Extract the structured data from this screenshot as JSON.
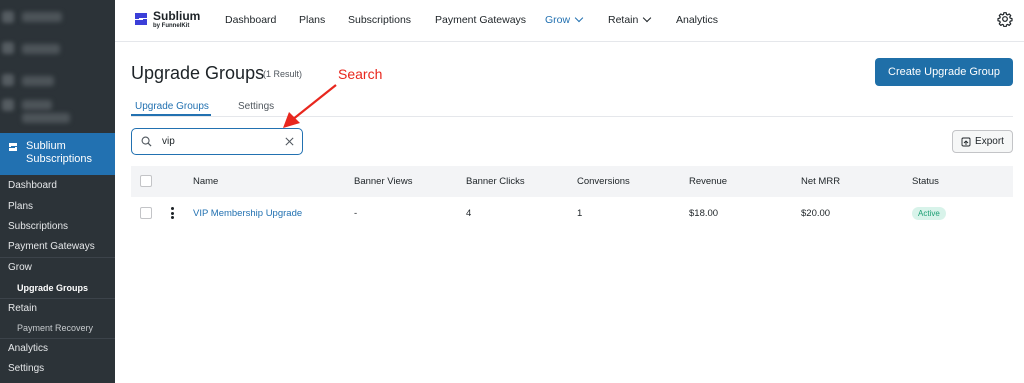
{
  "sidebar": {
    "active_label_line1": "Sublium",
    "active_label_line2": "Subscriptions",
    "items": [
      {
        "label": "Dashboard"
      },
      {
        "label": "Plans"
      },
      {
        "label": "Subscriptions"
      },
      {
        "label": "Payment Gateways"
      },
      {
        "label": "Grow"
      },
      {
        "label": "Upgrade Groups"
      },
      {
        "label": "Retain"
      },
      {
        "label": "Payment Recovery"
      },
      {
        "label": "Analytics"
      },
      {
        "label": "Settings"
      }
    ]
  },
  "brand": {
    "name": "Sublium",
    "sub": "by FunnelKit",
    "color": "#1d2327"
  },
  "topnav": {
    "items": [
      {
        "label": "Dashboard"
      },
      {
        "label": "Plans"
      },
      {
        "label": "Subscriptions"
      },
      {
        "label": "Payment Gateways"
      },
      {
        "label": "Grow"
      },
      {
        "label": "Retain"
      },
      {
        "label": "Analytics"
      }
    ],
    "active": "Grow"
  },
  "page": {
    "title": "Upgrade Groups",
    "result_count": "(1 Result)",
    "create_button": "Create Upgrade Group"
  },
  "tabs": [
    {
      "label": "Upgrade Groups",
      "active": true
    },
    {
      "label": "Settings",
      "active": false
    }
  ],
  "search": {
    "value": "vip"
  },
  "export_button": "Export",
  "table": {
    "headers": [
      "Name",
      "Banner Views",
      "Banner Clicks",
      "Conversions",
      "Revenue",
      "Net MRR",
      "Status"
    ],
    "rows": [
      {
        "name": "VIP Membership Upgrade",
        "banner_views": "-",
        "banner_clicks": "4",
        "conversions": "1",
        "revenue": "$18.00",
        "net_mrr": "$20.00",
        "status": "Active"
      }
    ]
  },
  "annotation": {
    "text": "Search",
    "color": "#e8271e"
  },
  "colors": {
    "accent": "#2271b1",
    "sidebar": "#2c3338",
    "active_badge": "#1a9e73"
  }
}
